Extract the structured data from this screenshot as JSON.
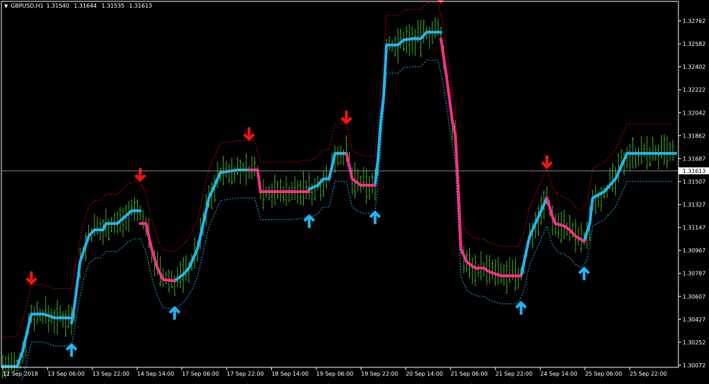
{
  "header": {
    "symbol": "GBPUSD,H1",
    "open": "1.31540",
    "high": "1.31644",
    "low": "1.31535",
    "close": "1.31613"
  },
  "colors": {
    "background": "#000000",
    "border": "#ffffff",
    "price_bars": "#3fb618",
    "uptrend": "#1fb6f5",
    "downtrend": "#ff2d8c",
    "upper_band": "#e00000",
    "lower_band": "#1fb6f5",
    "current_price_line": "#8a8a9a",
    "arrow_up": "#1fb6f5",
    "arrow_down": "#ff1010"
  },
  "chart_data": {
    "type": "line",
    "title": "GBPUSD,H1",
    "x_tick_labels": [
      "12 Sep 2018",
      "13 Sep 06:00",
      "13 Sep 22:00",
      "14 Sep 14:00",
      "17 Sep 06:00",
      "17 Sep 22:00",
      "18 Sep 14:00",
      "19 Sep 06:00",
      "19 Sep 22:00",
      "20 Sep 14:00",
      "21 Sep 06:00",
      "21 Sep 22:00",
      "24 Sep 14:00",
      "25 Sep 06:00",
      "25 Sep 22:00"
    ],
    "y_tick_labels": [
      "1.32762",
      "1.32582",
      "1.32402",
      "1.32222",
      "1.32042",
      "1.31862",
      "1.31687",
      "1.31507",
      "1.31327",
      "1.31147",
      "1.30967",
      "1.30787",
      "1.30607",
      "1.30427",
      "1.30252",
      "1.30072"
    ],
    "ylim": [
      1.30072,
      1.32942
    ],
    "current_price": 1.31613,
    "current_price_label": "1.31613",
    "bars_count": 235,
    "series": [
      {
        "name": "",
        "color": "#1fb6f5",
        "points": [
          [
            0,
            1.3008
          ],
          [
            5,
            1.3008
          ],
          [
            7,
            1.302
          ],
          [
            9,
            1.304
          ],
          [
            10,
            1.3049
          ],
          [
            14,
            1.3049
          ],
          [
            17,
            1.3047
          ],
          [
            18,
            1.3046
          ],
          [
            24,
            1.3046
          ]
        ]
      },
      {
        "name": "",
        "color": "#1fb6f5",
        "points": [
          [
            24,
            1.3042
          ],
          [
            25,
            1.3055
          ],
          [
            27,
            1.309
          ],
          [
            30,
            1.311
          ],
          [
            32,
            1.3115
          ],
          [
            35,
            1.3115
          ],
          [
            36,
            1.312
          ],
          [
            40,
            1.312
          ],
          [
            41,
            1.3122
          ],
          [
            45,
            1.313
          ],
          [
            48,
            1.313
          ]
        ]
      },
      {
        "name": "",
        "color": "#1fb6f5",
        "points": [
          [
            60,
            1.3075
          ],
          [
            63,
            1.308
          ],
          [
            65,
            1.3085
          ],
          [
            68,
            1.31
          ],
          [
            70,
            1.312
          ],
          [
            72,
            1.314
          ],
          [
            74,
            1.315
          ],
          [
            76,
            1.316
          ],
          [
            82,
            1.3162
          ],
          [
            86,
            1.3162
          ]
        ]
      },
      {
        "name": "",
        "color": "#1fb6f5",
        "points": [
          [
            107,
            1.3147
          ],
          [
            110,
            1.315
          ],
          [
            112,
            1.3155
          ],
          [
            114,
            1.3155
          ],
          [
            116,
            1.3175
          ],
          [
            120,
            1.3175
          ]
        ]
      },
      {
        "name": "",
        "color": "#1fb6f5",
        "points": [
          [
            130,
            1.315
          ],
          [
            131,
            1.317
          ],
          [
            132,
            1.32
          ],
          [
            133,
            1.322
          ],
          [
            134,
            1.326
          ],
          [
            138,
            1.326
          ],
          [
            140,
            1.3264
          ],
          [
            143,
            1.3265
          ],
          [
            146,
            1.3265
          ],
          [
            148,
            1.327
          ],
          [
            153,
            1.327
          ]
        ]
      },
      {
        "name": "",
        "color": "#1fb6f5",
        "points": [
          [
            181,
            1.3079
          ],
          [
            183,
            1.31
          ],
          [
            184,
            1.311
          ],
          [
            186,
            1.312
          ],
          [
            188,
            1.313
          ],
          [
            190,
            1.314
          ]
        ]
      },
      {
        "name": "",
        "color": "#1fb6f5",
        "points": [
          [
            203,
            1.3106
          ],
          [
            205,
            1.312
          ],
          [
            206,
            1.314
          ],
          [
            210,
            1.3145
          ],
          [
            212,
            1.315
          ],
          [
            214,
            1.3155
          ],
          [
            216,
            1.3165
          ],
          [
            218,
            1.3175
          ],
          [
            235,
            1.3175
          ]
        ]
      },
      {
        "name": "",
        "color": "#ff2d8c",
        "points": [
          [
            48,
            1.312
          ],
          [
            50,
            1.312
          ],
          [
            52,
            1.31
          ],
          [
            54,
            1.3085
          ],
          [
            56,
            1.3076
          ],
          [
            60,
            1.3075
          ]
        ]
      },
      {
        "name": "",
        "color": "#ff2d8c",
        "points": [
          [
            86,
            1.3162
          ],
          [
            89,
            1.3162
          ],
          [
            90,
            1.3145
          ],
          [
            101,
            1.3145
          ],
          [
            107,
            1.3145
          ]
        ]
      },
      {
        "name": "",
        "color": "#ff2d8c",
        "points": [
          [
            120,
            1.3175
          ],
          [
            122,
            1.3155
          ],
          [
            125,
            1.315
          ],
          [
            130,
            1.315
          ]
        ]
      },
      {
        "name": "",
        "color": "#ff2d8c",
        "points": [
          [
            153,
            1.3265
          ],
          [
            155,
            1.3235
          ],
          [
            157,
            1.32
          ],
          [
            158,
            1.319
          ],
          [
            159,
            1.315
          ],
          [
            160,
            1.31
          ],
          [
            161,
            1.3095
          ],
          [
            162,
            1.309
          ],
          [
            165,
            1.3085
          ],
          [
            168,
            1.3085
          ],
          [
            170,
            1.3082
          ],
          [
            174,
            1.3079
          ],
          [
            181,
            1.3079
          ]
        ]
      },
      {
        "name": "",
        "color": "#ff2d8c",
        "points": [
          [
            190,
            1.314
          ],
          [
            192,
            1.3125
          ],
          [
            193,
            1.312
          ],
          [
            196,
            1.3118
          ],
          [
            198,
            1.3115
          ],
          [
            200,
            1.311
          ],
          [
            203,
            1.3106
          ]
        ]
      }
    ],
    "buy_arrow_bars": [
      24,
      60,
      107,
      130,
      181,
      203
    ],
    "sell_arrow_bars": [
      10,
      48,
      86,
      120,
      153,
      190
    ]
  }
}
